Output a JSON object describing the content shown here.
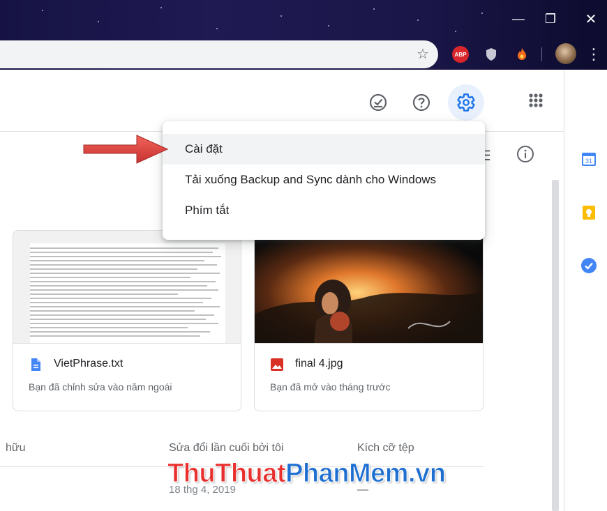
{
  "chrome": {
    "window_controls": {
      "minimize": "—",
      "restore": "❐",
      "close": "✕"
    },
    "extensions": [
      {
        "name": "abp-icon",
        "label": "ABP",
        "color": "#d9262c"
      },
      {
        "name": "shield-icon",
        "color": "#c9c9d6"
      },
      {
        "name": "flame-icon",
        "color": "#f26b1d"
      }
    ]
  },
  "header": {
    "icons": [
      "offline-check-icon",
      "help-icon",
      "settings-gear-icon",
      "apps-grid-icon",
      "account-avatar"
    ]
  },
  "menu": {
    "items": [
      {
        "label": "Cài đặt"
      },
      {
        "label": "Tải xuống Backup and Sync dành cho Windows"
      },
      {
        "label": "Phím tắt"
      }
    ]
  },
  "cards": [
    {
      "file_name": "VietPhrase.txt",
      "subtitle": "Bạn đã chỉnh sửa vào năm ngoái",
      "icon": "doc-icon",
      "icon_color": "#4285f4"
    },
    {
      "file_name": "final 4.jpg",
      "subtitle": "Bạn đã mở vào tháng trước",
      "icon": "image-icon",
      "icon_color": "#d93025"
    }
  ],
  "list": {
    "columns": [
      "hữu",
      "Sửa đổi lần cuối bởi tôi",
      "Kích cỡ tệp"
    ],
    "row": {
      "date": "18 thg 4, 2019",
      "size": "—"
    }
  },
  "watermark": {
    "part_a": "ThuThuat",
    "part_b": "PhanMem.vn"
  },
  "colors": {
    "accent": "#1a73e8",
    "menu_highlight": "#f1f3f4",
    "arrow": "#e53935"
  }
}
